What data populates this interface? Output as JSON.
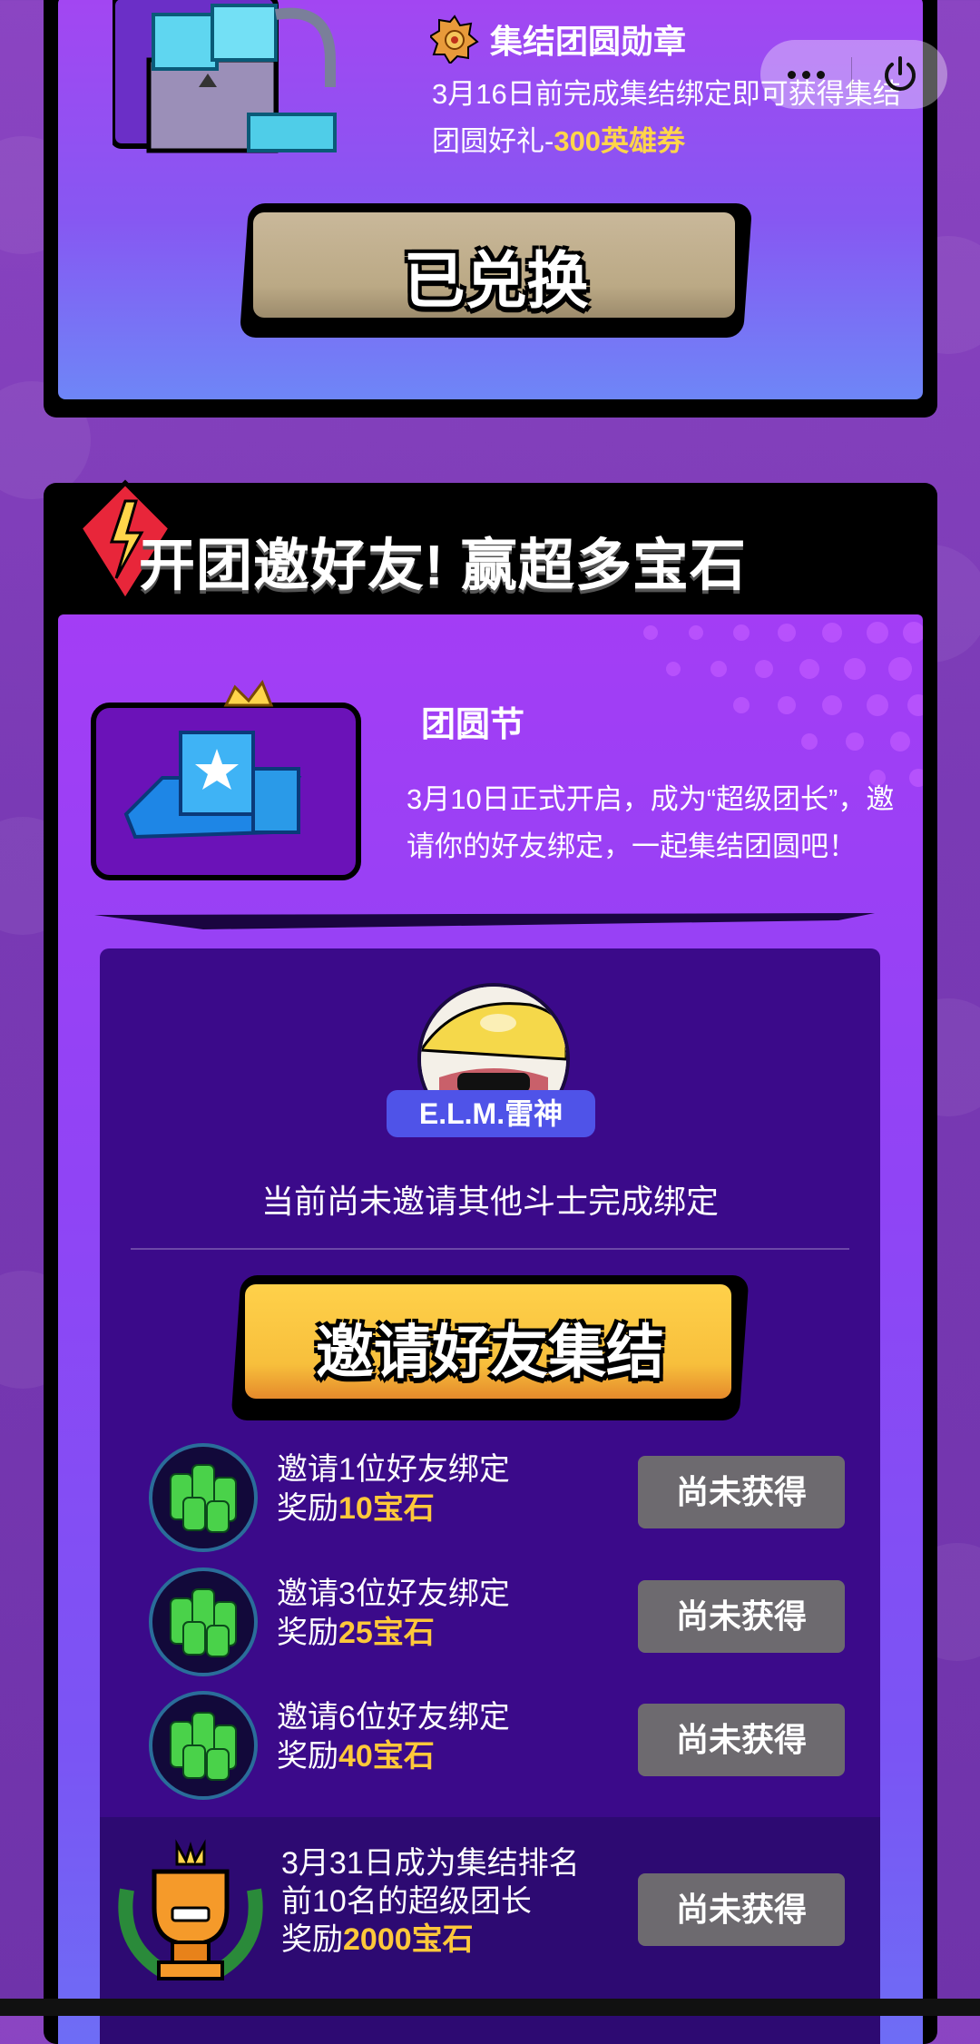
{
  "capsule": {
    "more_icon": "more-dots-icon",
    "close_icon": "power-icon"
  },
  "badge_card": {
    "title": "集结团圆勋章",
    "desc_prefix": "3月16日前完成集结绑定即可获得集结团圆好礼-",
    "desc_highlight": "300英雄券",
    "button_label": "已兑换",
    "colors": {
      "highlight": "#ffd54a",
      "button": "#c9b89a"
    }
  },
  "invite_card": {
    "header_title": "开团邀好友! 赢超多宝石",
    "feature_title": "团圆节",
    "feature_desc": "3月10日正式开启，成为“超级团长”，邀请你的好友绑定，一起集结团圆吧！",
    "player_name": "E.L.M.雷神",
    "status_text": "当前尚未邀请其他斗士完成绑定",
    "invite_button": "邀请好友集结",
    "rewards": [
      {
        "line1": "邀请1位好友绑定",
        "prefix": "奖励",
        "amount": "10宝石",
        "status": "尚未获得"
      },
      {
        "line1": "邀请3位好友绑定",
        "prefix": "奖励",
        "amount": "25宝石",
        "status": "尚未获得"
      },
      {
        "line1": "邀请6位好友绑定",
        "prefix": "奖励",
        "amount": "40宝石",
        "status": "尚未获得"
      }
    ],
    "top_reward": {
      "line1": "3月31日成为集结排名",
      "line2": "前10名的超级团长",
      "prefix": "奖励",
      "amount": "2000宝石",
      "status": "尚未获得"
    },
    "colors": {
      "highlight": "#ffc83a",
      "invite_button": "#f7bf3c",
      "status_button": "#6d6a6f",
      "panel": "#3b0a8a"
    }
  }
}
